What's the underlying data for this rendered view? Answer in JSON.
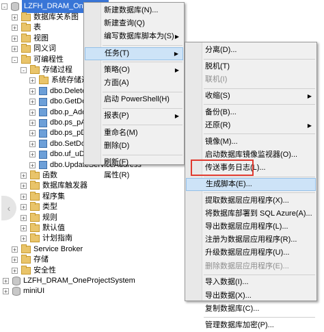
{
  "tree": {
    "root_label": "LZFH_DRAM_OnePlatfo",
    "items": [
      {
        "label": "数据库关系图",
        "level": 1,
        "expander": "+",
        "icon": "folder"
      },
      {
        "label": "表",
        "level": 1,
        "expander": "+",
        "icon": "folder"
      },
      {
        "label": "视图",
        "level": 1,
        "expander": "+",
        "icon": "folder"
      },
      {
        "label": "同义词",
        "level": 1,
        "expander": "+",
        "icon": "folder"
      },
      {
        "label": "可编程性",
        "level": 1,
        "expander": "-",
        "icon": "folder"
      },
      {
        "label": "存储过程",
        "level": 2,
        "expander": "-",
        "icon": "folder"
      },
      {
        "label": "系统存储过程",
        "level": 3,
        "expander": "+",
        "icon": "folder"
      },
      {
        "label": "dbo.DeleteD",
        "level": 3,
        "expander": "+",
        "icon": "proc"
      },
      {
        "label": "dbo.GetDocu",
        "level": 3,
        "expander": "+",
        "icon": "proc"
      },
      {
        "label": "dbo.p_AddA",
        "level": 3,
        "expander": "+",
        "icon": "proc"
      },
      {
        "label": "dbo.ps_pAdd",
        "level": 3,
        "expander": "+",
        "icon": "proc"
      },
      {
        "label": "dbo.ps_pDel",
        "level": 3,
        "expander": "+",
        "icon": "proc"
      },
      {
        "label": "dbo.SetDocu",
        "level": 3,
        "expander": "+",
        "icon": "proc"
      },
      {
        "label": "dbo.uf_uDele",
        "level": 3,
        "expander": "+",
        "icon": "proc"
      },
      {
        "label": "dbo.UpdateServiceAddress",
        "level": 3,
        "expander": "+",
        "icon": "proc"
      },
      {
        "label": "函数",
        "level": 2,
        "expander": "+",
        "icon": "folder"
      },
      {
        "label": "数据库触发器",
        "level": 2,
        "expander": "+",
        "icon": "folder"
      },
      {
        "label": "程序集",
        "level": 2,
        "expander": "+",
        "icon": "folder"
      },
      {
        "label": "类型",
        "level": 2,
        "expander": "+",
        "icon": "folder"
      },
      {
        "label": "规则",
        "level": 2,
        "expander": "+",
        "icon": "folder"
      },
      {
        "label": "默认值",
        "level": 2,
        "expander": "+",
        "icon": "folder"
      },
      {
        "label": "计划指南",
        "level": 2,
        "expander": "+",
        "icon": "folder"
      },
      {
        "label": "Service Broker",
        "level": 1,
        "expander": "+",
        "icon": "folder"
      },
      {
        "label": "存储",
        "level": 1,
        "expander": "+",
        "icon": "folder"
      },
      {
        "label": "安全性",
        "level": 1,
        "expander": "+",
        "icon": "folder"
      },
      {
        "label": "LZFH_DRAM_OneProjectSystem",
        "level": 0,
        "expander": "+",
        "icon": "db"
      },
      {
        "label": "miniUI",
        "level": 0,
        "expander": "+",
        "icon": "db"
      }
    ]
  },
  "context_menu": {
    "items": [
      {
        "label": "新建数据库(N)...",
        "type": "item"
      },
      {
        "label": "新建查询(Q)",
        "type": "item"
      },
      {
        "label": "编写数据库脚本为(S)",
        "type": "submenu"
      },
      {
        "type": "sep"
      },
      {
        "label": "任务(T)",
        "type": "submenu",
        "selected": true
      },
      {
        "type": "sep"
      },
      {
        "label": "策略(O)",
        "type": "submenu"
      },
      {
        "label": "方面(A)",
        "type": "item"
      },
      {
        "type": "sep"
      },
      {
        "label": "启动 PowerShell(H)",
        "type": "item"
      },
      {
        "type": "sep"
      },
      {
        "label": "报表(P)",
        "type": "submenu"
      },
      {
        "type": "sep"
      },
      {
        "label": "重命名(M)",
        "type": "item"
      },
      {
        "label": "删除(D)",
        "type": "item"
      },
      {
        "type": "sep"
      },
      {
        "label": "刷新(F)",
        "type": "item"
      },
      {
        "label": "属性(R)",
        "type": "item"
      }
    ]
  },
  "task_submenu": {
    "items": [
      {
        "label": "分离(D)...",
        "type": "item"
      },
      {
        "type": "sep"
      },
      {
        "label": "脱机(T)",
        "type": "item"
      },
      {
        "label": "联机(I)",
        "type": "item",
        "disabled": true
      },
      {
        "type": "sep"
      },
      {
        "label": "收缩(S)",
        "type": "submenu"
      },
      {
        "type": "sep"
      },
      {
        "label": "备份(B)...",
        "type": "item"
      },
      {
        "label": "还原(R)",
        "type": "submenu"
      },
      {
        "type": "sep"
      },
      {
        "label": "镜像(M)...",
        "type": "item"
      },
      {
        "label": "启动数据库镜像监视器(O)...",
        "type": "item"
      },
      {
        "label": "传送事务日志(L)...",
        "type": "item"
      },
      {
        "type": "sep"
      },
      {
        "label": "生成脚本(E)...",
        "type": "item",
        "selected": true
      },
      {
        "type": "sep"
      },
      {
        "label": "提取数据层应用程序(X)...",
        "type": "item"
      },
      {
        "label": "将数据库部署到 SQL Azure(A)...",
        "type": "item"
      },
      {
        "label": "导出数据层应用程序(L)...",
        "type": "item"
      },
      {
        "label": "注册为数据层应用程序(R)...",
        "type": "item"
      },
      {
        "label": "升级数据层应用程序(U)...",
        "type": "item"
      },
      {
        "label": "删除数据层应用程序(E)...",
        "type": "item",
        "disabled": true
      },
      {
        "type": "sep"
      },
      {
        "label": "导入数据(I)...",
        "type": "item"
      },
      {
        "label": "导出数据(X)...",
        "type": "item"
      },
      {
        "label": "复制数据库(C)...",
        "type": "item"
      },
      {
        "type": "sep"
      },
      {
        "label": "管理数据库加密(P)...",
        "type": "item"
      }
    ]
  },
  "colors": {
    "selection": "#3875d7",
    "highlight_box": "#e03a2f",
    "menu_hover": "#cde3f7"
  },
  "left_tab_glyph": "‹"
}
